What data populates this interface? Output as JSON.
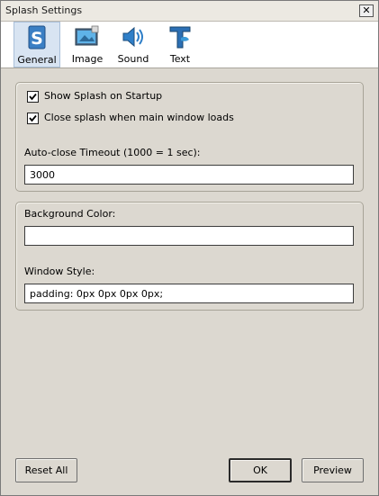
{
  "window": {
    "title": "Splash Settings",
    "close_glyph": "✕"
  },
  "tabs": [
    {
      "label": "General",
      "icon": "splash-s-icon",
      "active": true
    },
    {
      "label": "Image",
      "icon": "image-icon",
      "active": false
    },
    {
      "label": "Sound",
      "icon": "speaker-icon",
      "active": false
    },
    {
      "label": "Text",
      "icon": "text-t-icon",
      "active": false
    }
  ],
  "general": {
    "show_splash_label": "Show Splash on Startup",
    "show_splash_checked": true,
    "close_splash_label": "Close splash when main window loads",
    "close_splash_checked": true,
    "timeout_label": "Auto-close Timeout (1000 = 1 sec):",
    "timeout_value": "3000"
  },
  "appearance": {
    "bg_color_label": "Background Color:",
    "bg_color_value": "",
    "window_style_label": "Window Style:",
    "window_style_value": "padding: 0px 0px 0px 0px;"
  },
  "buttons": {
    "reset": "Reset All",
    "ok": "OK",
    "preview": "Preview"
  },
  "colors": {
    "active_tab": "#d8e4f2",
    "dialog_bg": "#dcd8d0"
  }
}
